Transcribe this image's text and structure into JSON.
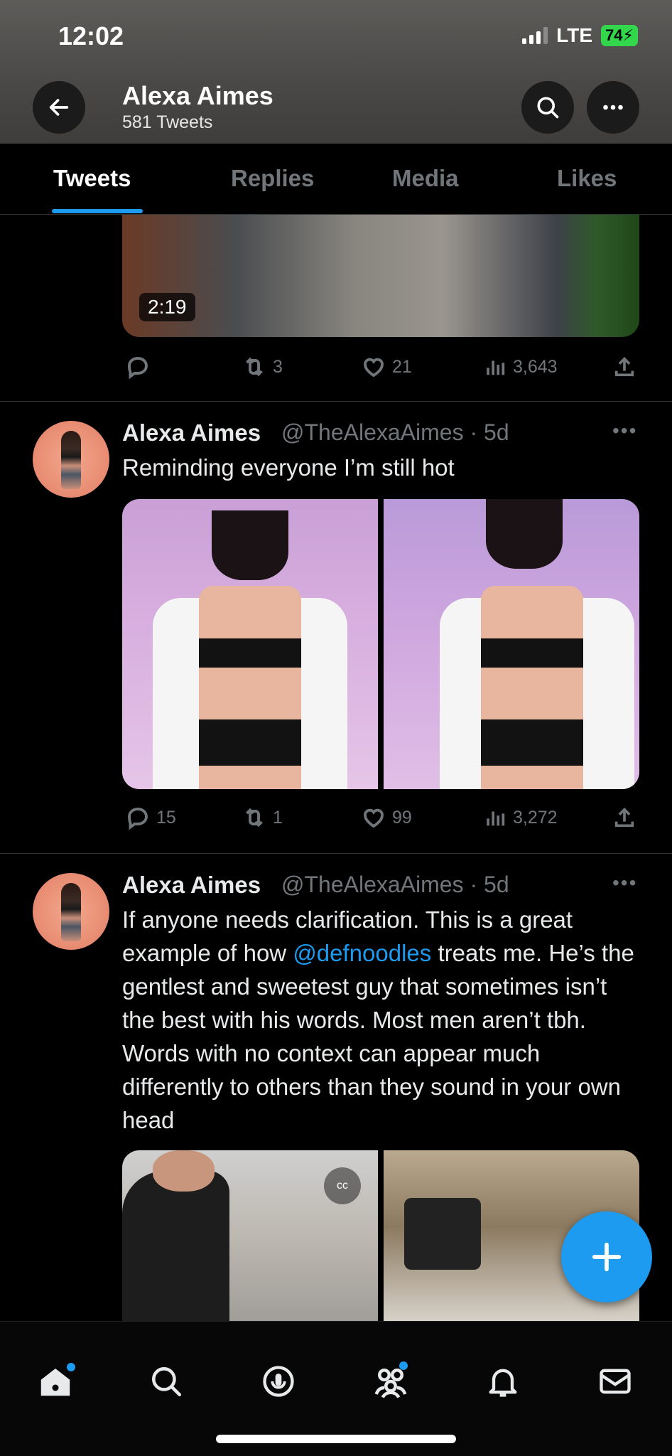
{
  "status_bar": {
    "time": "12:02",
    "network": "LTE",
    "battery": "74"
  },
  "header": {
    "name": "Alexa Aimes",
    "tweet_count": "581 Tweets"
  },
  "tabs": [
    {
      "label": "Tweets",
      "active": true
    },
    {
      "label": "Replies",
      "active": false
    },
    {
      "label": "Media",
      "active": false
    },
    {
      "label": "Likes",
      "active": false
    }
  ],
  "tweet0": {
    "video_duration": "2:19",
    "replies": "",
    "retweets": "3",
    "likes": "21",
    "views": "3,643"
  },
  "tweet1": {
    "name": "Alexa Aimes",
    "handle": "@TheAlexaAimes · 5d",
    "text": "Reminding everyone I’m still hot",
    "replies": "15",
    "retweets": "1",
    "likes": "99",
    "views": "3,272"
  },
  "tweet2": {
    "name": "Alexa Aimes",
    "handle": "@TheAlexaAimes · 5d",
    "text_lead": "If anyone needs clarification. This is a great example of how ",
    "mention": "@defnoodles",
    "text_tail": " treats me. He’s the gentlest and sweetest guy that sometimes isn’t the best with his words. Most men aren’t tbh. Words with no context can appear much differently to others than they sound in your own head"
  },
  "colors": {
    "accent": "#1d9bf0",
    "background": "#000000",
    "muted": "#71767b"
  },
  "icons": {
    "nav": [
      "home-icon",
      "search-icon",
      "spaces-icon",
      "communities-icon",
      "notifications-icon",
      "messages-icon"
    ],
    "actions": [
      "reply-icon",
      "retweet-icon",
      "like-icon",
      "views-icon",
      "share-icon"
    ]
  }
}
